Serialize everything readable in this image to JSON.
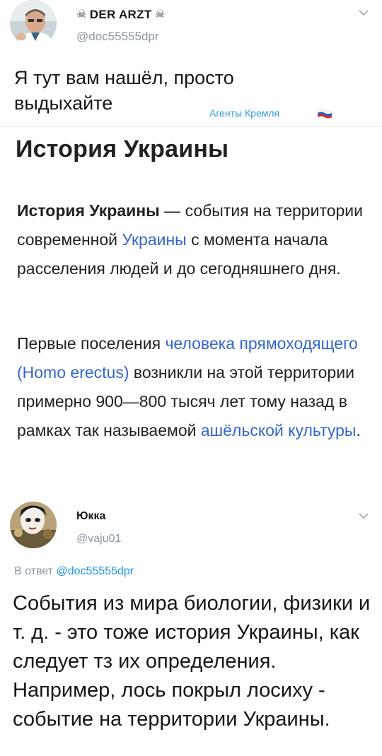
{
  "tweet": {
    "author_name": "DER ARZT",
    "name_decoration_icon": "skull-crossbones-icon",
    "handle": "@doc55555dpr",
    "text_line1": "Я тут вам нашёл, просто",
    "text_line2": "выдыхайте"
  },
  "watermark": {
    "text": "Агенты Кремля",
    "flag_icon": "russian-flag-icon"
  },
  "wiki": {
    "title": "История Украины",
    "p1_bold": "История Украины",
    "p1_text_a": " — события на территории современной ",
    "p1_link": "Украины",
    "p1_text_b": " с момента начала расселения людей и до сегодняшнего дня.",
    "p2_text_a": "Первые поселения ",
    "p2_link1": "человека прямоходящего (Homo erectus)",
    "p2_text_b": " возникли на этой территории примерно 900—800 тысяч лет тому назад в рамках так называемой ",
    "p2_link2": "ашёльской культуры",
    "p2_text_c": ".",
    "link_color": "#3366cc"
  },
  "reply": {
    "author_name": "Юкка",
    "handle": "@vaju01",
    "in_reply_label": "В ответ ",
    "in_reply_mention": "@doc55555dpr",
    "text": "События из мира биологии, физики и т. д. - это тоже история Украины, как следует тз их определения. Например,  лось покрыл лосиху - событие на территории Украины."
  },
  "colors": {
    "text": "#14171a",
    "secondary": "#8899a6",
    "mention": "#1b95e0",
    "watermark": "#2f9cda"
  }
}
